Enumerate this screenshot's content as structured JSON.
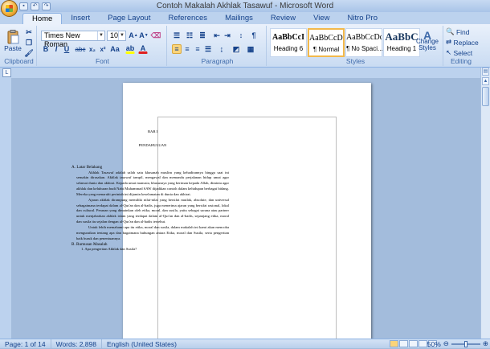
{
  "window": {
    "title": "Contoh Makalah Akhlak Tasawuf - Microsoft Word"
  },
  "tabs": [
    "Home",
    "Insert",
    "Page Layout",
    "References",
    "Mailings",
    "Review",
    "View",
    "Nitro Pro"
  ],
  "ribbon": {
    "clipboard": {
      "label": "Clipboard",
      "paste": "Paste"
    },
    "font": {
      "label": "Font",
      "name": "Times New Roman",
      "size": "10"
    },
    "paragraph": {
      "label": "Paragraph"
    },
    "styles": {
      "label": "Styles",
      "items": [
        {
          "sample": "AaBbCcI",
          "name": "Heading 6"
        },
        {
          "sample": "AaBbCcDc",
          "name": "¶ Normal"
        },
        {
          "sample": "AaBbCcDc",
          "name": "¶ No Spaci..."
        },
        {
          "sample": "AaBbC",
          "name": "Heading 1"
        }
      ],
      "change_styles": "Change Styles"
    },
    "editing": {
      "label": "Editing",
      "find": "Find",
      "replace": "Replace",
      "select": "Select"
    }
  },
  "document": {
    "bab": "BAB  I",
    "chapter_title": "PENDAHULUAN",
    "section_a": "A.   Latar Belakang",
    "para1": "Akhlak  Tasawuf  adalah  salah  satu  khasanah  muslim  yang kehadirannya hingga saat  ini  semakin dirasakan. Akhlak tasawuf tampil, mengawal dan memandu perjalanan hidup  umat  agar  selamat dunia dan akhirat. Kepada umat  manusia, khususnya yang  beriman kepada Allah, diminta agar akhlak dan keluhuran budi  Nabi  Muhammad SAW dijadikan contoh dalam  kehidupan berbagai bidang. Mereka yang  menaruhi perintah ini dijamin keselamatan di dunia dan akhirat.",
    "para2": "Ajaran akhlak dirampung memiliki nilai-nilai yang  bersifat mutlak, absolute, dan  universal sebagaimana terdapat dalam  al-Qur'an dan  al-hadis,  juga  menerima ajaran  yang  bersifat rasional, lokal dan  cultural. Peranan yang dimainkan oleh etika, moral, dan susila, yaitu  sebagai sarana atau  partner untuk  menjabarkan akhlak islam  yang  terdapat dalam  al-Qur'an dan al-hadis, sepanjang etika,  moral  dan  susila itu  sejalan dengan al-Qur'an dan al-hadis tersebut.",
    "para3": "Untuk  lebih  memahami apa itu etika, moral dan susila, dalam makalah ini  kami  akan  mencoba menguraikan tentang apa dan  bagaimana hubungan antara  Etika,  moral  dan  Susila, serta pengertian baik buruk dan penentuannya.",
    "section_b": "B.   Rumusan  Masalah",
    "b1": "1.   Apa pengertian Akhlak dan Susila?"
  },
  "status": {
    "page": "Page: 1 of 14",
    "words": "Words: 2,898",
    "language": "English (United States)",
    "zoom": "50%"
  }
}
